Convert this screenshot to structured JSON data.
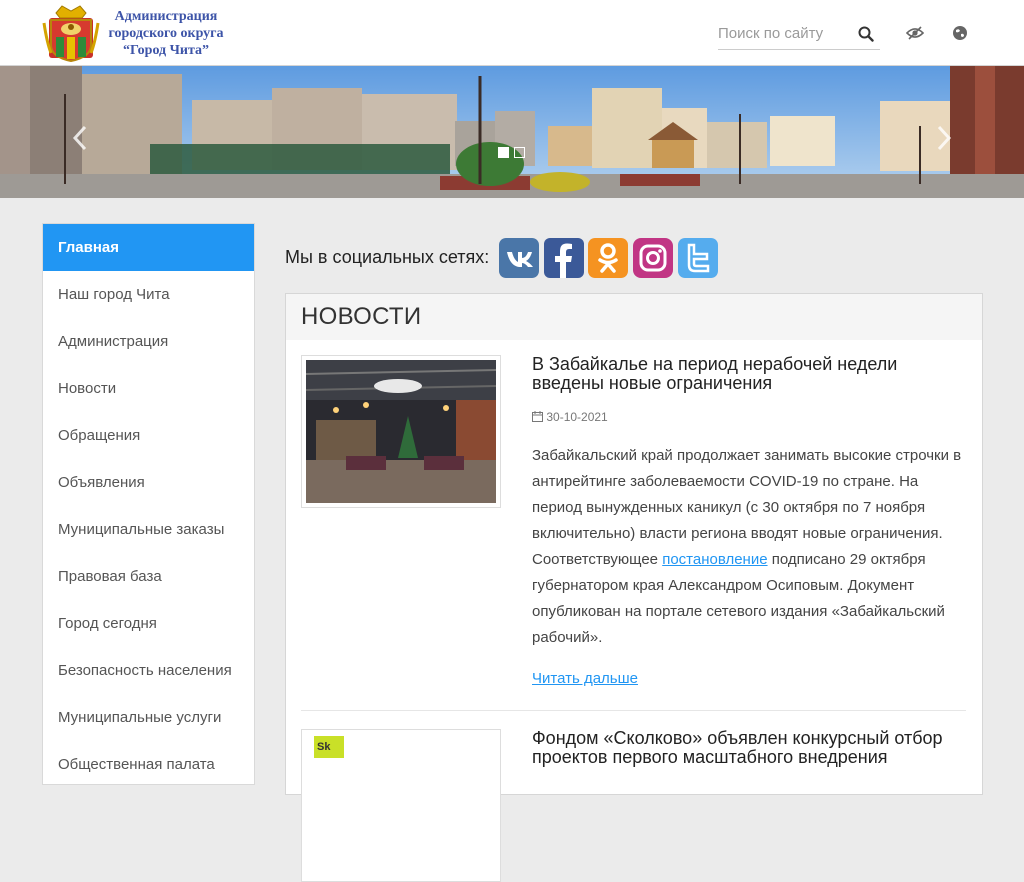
{
  "header": {
    "logo_lines": [
      "Администрация",
      "городского округа",
      "“Город Чита”"
    ],
    "search_placeholder": "Поиск по сайту",
    "icons": [
      "search-icon",
      "accessibility-eye-icon",
      "globe-language-icon"
    ]
  },
  "banner": {
    "slides_count": 2,
    "active_slide": 1,
    "icons": [
      "chevron-left-icon",
      "chevron-right-icon"
    ]
  },
  "sidebar": {
    "items": [
      {
        "label": "Главная",
        "active": true
      },
      {
        "label": "Наш город Чита"
      },
      {
        "label": "Администрация"
      },
      {
        "label": "Новости"
      },
      {
        "label": "Обращения"
      },
      {
        "label": "Объявления"
      },
      {
        "label": "Муниципальные заказы"
      },
      {
        "label": "Правовая база"
      },
      {
        "label": "Город сегодня"
      },
      {
        "label": "Безопасность населения"
      },
      {
        "label": "Муниципальные услуги"
      },
      {
        "label": "Общественная палата"
      }
    ]
  },
  "social": {
    "label": "Мы в социальных сетях:",
    "networks": [
      {
        "name": "vk-icon",
        "color": "#4a76a8"
      },
      {
        "name": "facebook-icon",
        "color": "#3b5998"
      },
      {
        "name": "odnoklassniki-icon",
        "color": "#f59321"
      },
      {
        "name": "instagram-icon",
        "color": "#c13584"
      },
      {
        "name": "twitter-icon",
        "color": "#55acee"
      }
    ]
  },
  "news": {
    "heading": "НОВОСТИ",
    "articles": [
      {
        "title": "В Забайкалье на период нерабочей недели введены новые ограничения",
        "date": "30-10-2021",
        "text_before_link": "Забайкальский край продолжает занимать высокие строчки в антирейтинге заболеваемости COVID-19 по стране. На период вынужденных каникул (с 30 октября по 7 ноября включительно) власти региона вводят новые ограничения. Соответствующее ",
        "link_text": "постановление",
        "text_after_link": " подписано 29 октября губернатором края Александром Осиповым. Документ опубликован на портале сетевого издания «Забайкальский рабочий».",
        "read_more": "Читать дальше"
      },
      {
        "title": "Фондом «Сколково» объявлен конкурсный отбор проектов первого масштабного внедрения",
        "thumb_logo": "Sk"
      }
    ]
  },
  "colors": {
    "accent": "#2196f3",
    "logo_text": "#3d54a8",
    "page_bg": "#ebebeb"
  }
}
